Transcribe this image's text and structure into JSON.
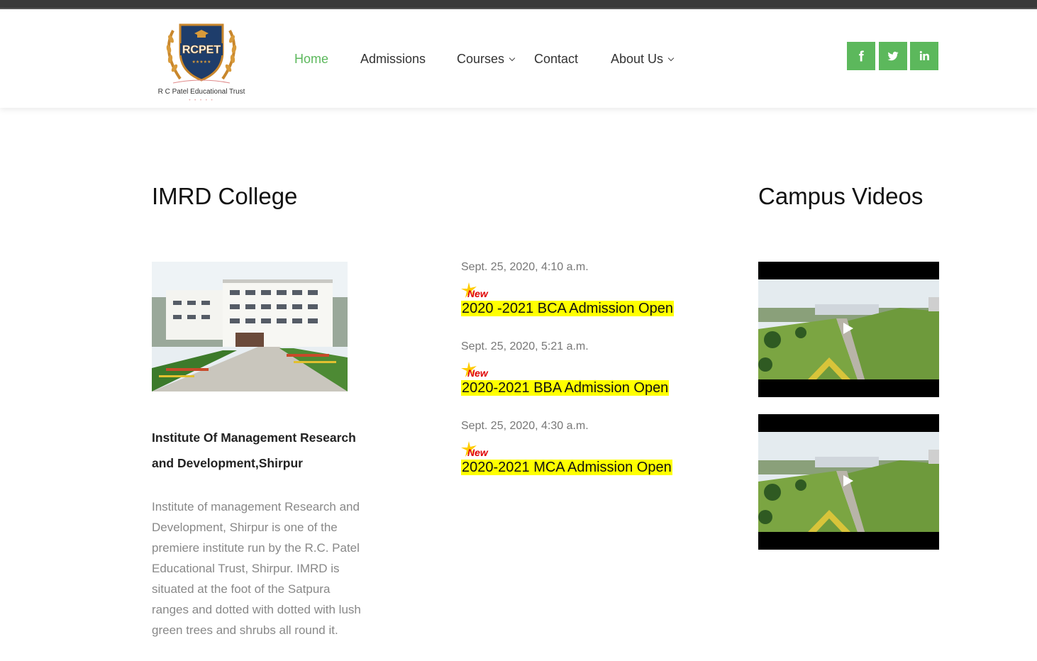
{
  "header": {
    "logo": {
      "brand": "RCPET",
      "tagline": "R C Patel Educational Trust"
    },
    "nav": [
      {
        "label": "Home",
        "active": true
      },
      {
        "label": "Admissions"
      },
      {
        "label": "Courses",
        "dropdown": true
      },
      {
        "label": "Contact"
      },
      {
        "label": "About Us",
        "dropdown": true
      }
    ],
    "social": [
      "facebook-icon",
      "twitter-icon",
      "linkedin-icon"
    ],
    "colors": {
      "accent": "#5cb85c",
      "topbar": "#3a3a3a"
    }
  },
  "college": {
    "heading": "IMRD College",
    "name": "Institute Of Management Research and Development,Shirpur",
    "description": "Institute of management Research and Development, Shirpur is one of the premiere institute run by the R.C. Patel Educational Trust, Shirpur. IMRD is situated at the foot of the Satpura ranges and dotted with dotted with lush green trees and shrubs all round it."
  },
  "news": {
    "badge": "New",
    "items": [
      {
        "date": "Sept. 25, 2020, 4:10 a.m.",
        "title": "2020 -2021 BCA Admission Open"
      },
      {
        "date": "Sept. 25, 2020, 5:21 a.m.",
        "title": "2020-2021 BBA Admission Open"
      },
      {
        "date": "Sept. 25, 2020, 4:30 a.m.",
        "title": "2020-2021 MCA Admission Open"
      }
    ],
    "highlight_color": "#ffff00"
  },
  "videos": {
    "heading": "Campus Videos",
    "items": [
      {
        "kind": "campus-video"
      },
      {
        "kind": "campus-video"
      }
    ]
  }
}
